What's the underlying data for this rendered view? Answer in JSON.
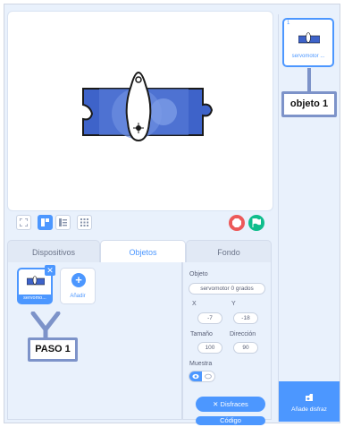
{
  "stage": {
    "toolbar": {
      "small_stage_icon": "small-stage-icon",
      "normal_stage_icon": "normal-stage-icon",
      "large_stage_icon": "large-stage-icon",
      "fullscreen_icon": "fullscreen-icon",
      "stop_icon": "stop-icon",
      "green_flag_icon": "green-flag-icon"
    }
  },
  "tabs": [
    {
      "label": "Dispositivos"
    },
    {
      "label": "Objetos"
    },
    {
      "label": "Fondo"
    }
  ],
  "sprites": {
    "items": [
      {
        "name": "servomo..."
      }
    ],
    "add_label": "Añadir"
  },
  "annotations": {
    "paso": "PASO 1",
    "objeto": "objeto 1"
  },
  "properties": {
    "object_label": "Objeto",
    "object_value": "servomotor 0 grados",
    "x_label": "X",
    "x_value": "-7",
    "y_label": "Y",
    "y_value": "-18",
    "size_label": "Tamaño",
    "size_value": "100",
    "direction_label": "Dirección",
    "direction_value": "90",
    "show_label": "Muestra",
    "costumes_button": "Disfraces",
    "code_button": "Código"
  },
  "costumes": {
    "items": [
      {
        "number": "1",
        "name": "servomotor ..."
      }
    ],
    "add_label": "Añade disfraz"
  },
  "colors": {
    "accent": "#4c97ff",
    "servo_body": "#3e63c9",
    "stop": "#ec5959",
    "go": "#0fbd8c",
    "callout_border": "#7d93c9"
  }
}
